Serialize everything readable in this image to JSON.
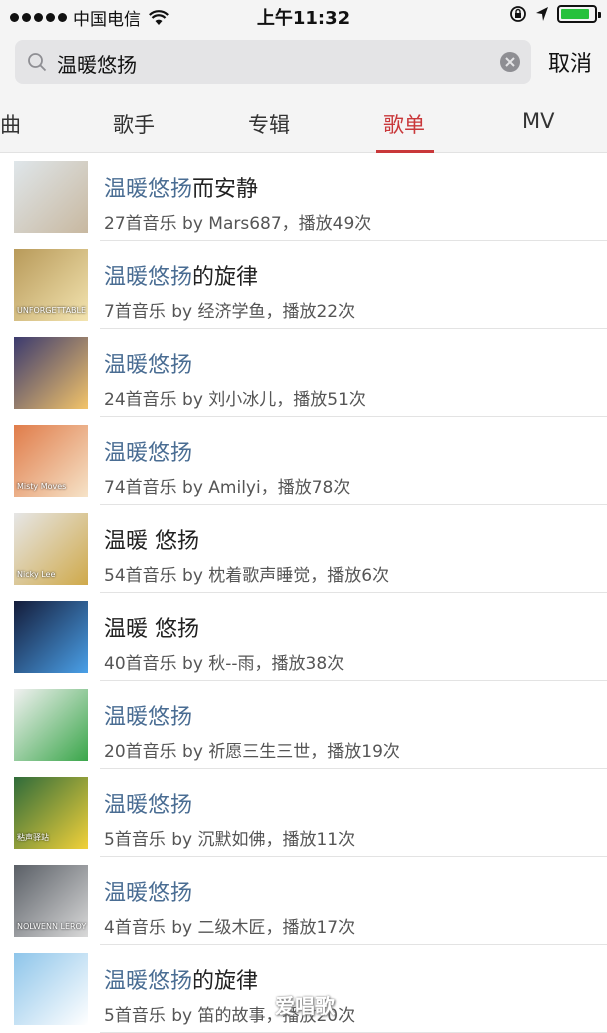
{
  "status_bar": {
    "carrier": "中国电信",
    "time": "上午11:32",
    "battery_color": "#26c13b"
  },
  "search": {
    "query": "温暖悠扬",
    "cancel_label": "取消"
  },
  "tabs": [
    {
      "label": "曲",
      "active": false
    },
    {
      "label": "歌手",
      "active": false
    },
    {
      "label": "专辑",
      "active": false
    },
    {
      "label": "歌单",
      "active": true
    },
    {
      "label": "MV",
      "active": false
    }
  ],
  "accent_color": "#c9383a",
  "highlight_color": "#4a6d93",
  "playlists": [
    {
      "title_hl": "温暖悠扬",
      "title_rest": "而安静",
      "meta": "27首音乐  by Mars687，播放49次"
    },
    {
      "title_hl": "温暖悠扬",
      "title_rest": "的旋律",
      "meta": "7首音乐  by 经济学鱼，播放22次"
    },
    {
      "title_hl": "温暖悠扬",
      "title_rest": "",
      "meta": "24首音乐  by 刘小冰儿，播放51次"
    },
    {
      "title_hl": "温暖悠扬",
      "title_rest": "",
      "meta": "74首音乐  by Amilyi，播放78次"
    },
    {
      "title_hl": "",
      "title_rest": "温暖 悠扬",
      "meta": "54首音乐  by 枕着歌声睡觉，播放6次"
    },
    {
      "title_hl": "",
      "title_rest": "温暖 悠扬",
      "meta": "40首音乐  by 秋--雨，播放38次"
    },
    {
      "title_hl": "温暖悠扬",
      "title_rest": "",
      "meta": "20首音乐  by 祈愿三生三世，播放19次"
    },
    {
      "title_hl": "温暖悠扬",
      "title_rest": "",
      "meta": "5首音乐  by 沉默如佛，播放11次"
    },
    {
      "title_hl": "温暖悠扬",
      "title_rest": "",
      "meta": "4首音乐  by 二级木匠，播放17次"
    },
    {
      "title_hl": "温暖悠扬",
      "title_rest": "的旋律",
      "meta": "5首音乐  by 笛的故事，播放20次"
    }
  ],
  "covers": [
    {
      "name": "beach-girls-cover",
      "bg": "#dfe6ea",
      "accent": "#c8b8a0"
    },
    {
      "name": "unforgettable-cover",
      "bg": "#b89a5a",
      "accent": "#f3e4b0",
      "text": "UNFORGETTABLE"
    },
    {
      "name": "sunset-cover",
      "bg": "#3b3a6e",
      "accent": "#f3c46a"
    },
    {
      "name": "misty-cover",
      "bg": "#e07c4a",
      "accent": "#f6e3c8",
      "text": "Misty Moves"
    },
    {
      "name": "nicky-lee-cover",
      "bg": "#e6e6e6",
      "accent": "#cfa94a",
      "text": "Nicky Lee"
    },
    {
      "name": "concert-cover",
      "bg": "#141c3a",
      "accent": "#4aa0e8"
    },
    {
      "name": "comic-cover",
      "bg": "#f1f1f1",
      "accent": "#3aa64a"
    },
    {
      "name": "group-cover",
      "bg": "#2f6b3a",
      "accent": "#f2d13a",
      "text": "粘声驿站"
    },
    {
      "name": "nolwenn-cover",
      "bg": "#5a5f66",
      "accent": "#d9d9d9",
      "text": "NOLWENN LEROY"
    },
    {
      "name": "sky-cover",
      "bg": "#8ec5ea",
      "accent": "#ffffff"
    }
  ],
  "watermark": "爱唱歌"
}
